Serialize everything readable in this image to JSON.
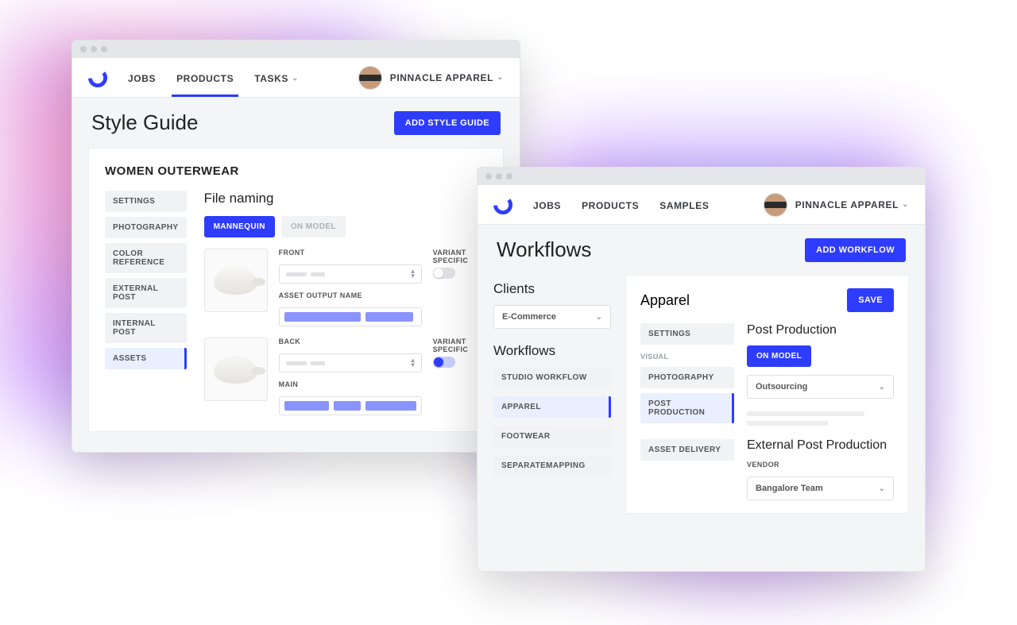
{
  "colors": {
    "primary": "#2e3cff"
  },
  "win1": {
    "nav": {
      "items": [
        "JOBS",
        "PRODUCTS",
        "TASKS"
      ],
      "active": "PRODUCTS"
    },
    "user": "PINNACLE APPAREL",
    "page_title": "Style Guide",
    "add_btn": "ADD STYLE GUIDE",
    "card_title": "WOMEN OUTERWEAR",
    "side_items": [
      "SETTINGS",
      "PHOTOGRAPHY",
      "COLOR REFERENCE",
      "EXTERNAL POST",
      "INTERNAL POST",
      "ASSETS"
    ],
    "side_active": "ASSETS",
    "section_title": "File naming",
    "pills": {
      "active": "MANNEQUIN",
      "inactive": "ON MODEL"
    },
    "rows": [
      {
        "select_label": "FRONT",
        "output_label": "ASSET OUTPUT NAME",
        "variant_label": "VARIANT SPECIFIC",
        "variant_on": false
      },
      {
        "select_label": "BACK",
        "output_label": "MAIN",
        "variant_label": "VARIANT SPECIFIC",
        "variant_on": true
      }
    ]
  },
  "win2": {
    "nav": {
      "items": [
        "JOBS",
        "PRODUCTS",
        "SAMPLES"
      ]
    },
    "user": "PINNACLE APPAREL",
    "page_title": "Workflows",
    "add_btn": "ADD WORKFLOW",
    "left": {
      "clients_title": "Clients",
      "client_select": "E-Commerce",
      "workflows_title": "Workflows",
      "workflow_items": [
        "STUDIO WORKFLOW",
        "APPAREL",
        "FOOTWEAR",
        "SEPARATEMAPPING"
      ],
      "workflow_active": "APPAREL"
    },
    "main": {
      "title": "Apparel",
      "save_btn": "SAVE",
      "side_settings": "SETTINGS",
      "group_visual": "VISUAL",
      "side_items": [
        "PHOTOGRAPHY",
        "POST PRODUCTION"
      ],
      "side_active": "POST PRODUCTION",
      "side_asset": "ASSET DELIVERY",
      "post_title": "Post Production",
      "on_model_btn": "ON MODEL",
      "outsourcing_select": "Outsourcing",
      "ext_title": "External Post Production",
      "vendor_label": "VENDOR",
      "vendor_select": "Bangalore Team"
    }
  }
}
